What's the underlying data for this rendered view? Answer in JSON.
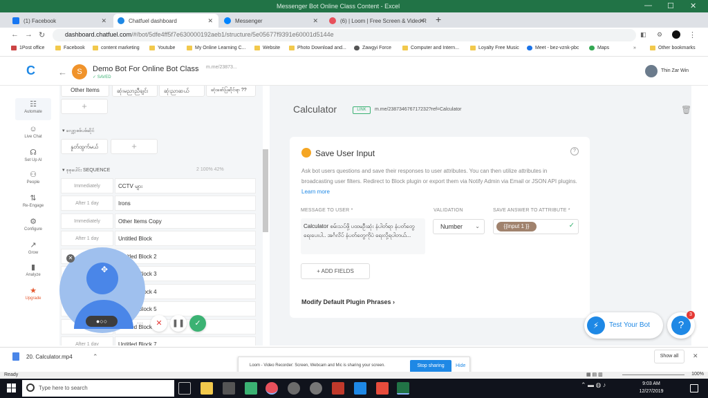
{
  "excel": {
    "title": "Messenger Bot Online Class Content - Excel",
    "min": "—",
    "max": "☐",
    "close": "✕"
  },
  "tabs": [
    {
      "title": "(1) Facebook",
      "color": "#1877f2"
    },
    {
      "title": "Chatfuel dashboard",
      "color": "#1e88e5"
    },
    {
      "title": "Messenger",
      "color": "#0084ff"
    },
    {
      "title": "(6) | Loom | Free Screen & Video R",
      "color": "#e8505b"
    }
  ],
  "address": {
    "domain": "dashboard.chatfuel.com",
    "path": "/#/bot/5dfe4ff5f7e630000192aeb1/structure/5e05677f9391e60001d5144e"
  },
  "bookmarks": [
    "1Post office",
    "Facebook",
    "content marketing",
    "Youtube",
    "My Online Learning C...",
    "Website",
    "Photo Download and...",
    "Zawgyi Force",
    "Computer and Intern...",
    "Loyalty Free Music",
    "Meet - bez-vznk-pbc",
    "Maps",
    "Other bookmarks"
  ],
  "header": {
    "logo": "C",
    "avatar_letter": "S",
    "bot_name": "Demo Bot For Online Bot Class",
    "saved": "SAVED",
    "bot_link": "m.me/23873...",
    "user_name": "Thin Zar Win"
  },
  "nav": [
    {
      "label": "Automate",
      "icon": "☷"
    },
    {
      "label": "Live Chat",
      "icon": "☺"
    },
    {
      "label": "Set Up AI",
      "icon": "☊"
    },
    {
      "label": "People",
      "icon": "⚇"
    },
    {
      "label": "Re-Engage",
      "icon": "⇅"
    },
    {
      "label": "Configure",
      "icon": "⚙"
    },
    {
      "label": "Grow",
      "icon": "↗"
    },
    {
      "label": "Analyze",
      "icon": "▮"
    },
    {
      "label": "Upgrade",
      "icon": "★"
    }
  ],
  "blocks": {
    "top_row": [
      "Other Items",
      "ဆုံးမညာညီချင်း",
      "ဆုံးညာဆယ်",
      "ဆုံးဖော်ပြဆိုင်ရာ ??"
    ],
    "group2_title": "လျှော့စစ်ပစ်ဆိုင်",
    "group2_blocks": [
      "နှုတ်ထွက်မယ်"
    ],
    "seq_title": "စုစုပေါင်း SEQUENCE",
    "seq_stats": "2   100%   42%",
    "sequence": [
      {
        "when": "Immediately",
        "name": "CCTV များ"
      },
      {
        "when": "After 1 day",
        "name": "Irons"
      },
      {
        "when": "Immediately",
        "name": "Other Items Copy"
      },
      {
        "when": "After 1 day",
        "name": "Untitled Block"
      },
      {
        "when": "",
        "name": "Untitled Block 2"
      },
      {
        "when": "",
        "name": "Untitled Block 3"
      },
      {
        "when": "",
        "name": "Untitled Block 4"
      },
      {
        "when": "",
        "name": "Untitled Block 5"
      },
      {
        "when": "After",
        "name": "Untitled Block 6"
      },
      {
        "when": "After 1 day",
        "name": "Untitled Block 7"
      }
    ]
  },
  "editor": {
    "block_title": "Calculator",
    "link_badge": "LINK",
    "link_url": "m.me/238734676717232?ref=Calculator",
    "plugin_title": "Save User Input",
    "help": "?",
    "desc": "Ask bot users questions and save their responses to user attributes. You can then utilize attributes in broadcasting user filters. Redirect to Block plugin or export them via Notify Admin via Email or JSON API plugins.",
    "learn_more": "Learn more",
    "label_message": "MESSAGE TO USER *",
    "label_validation": "VALIDATION",
    "label_attribute": "SAVE ANSWER TO ATTRIBUTE *",
    "message": "Calculator စမ်းသပ်ဖို့ ပထမဦးဆုံး နံပါတ်ရာ နံပတ်တွေ ရေးပေးပါ.. အင်္ဂလိပ် နံပတ်တွေကိုပဲ ရေးလို့ရပါတယ်...",
    "validation": "Number",
    "attribute": "{{input 1 }}",
    "add_fields": "ADD FIELDS",
    "modify": "Modify Default Plugin Phrases"
  },
  "fabs": {
    "test_bot": "Test Your Bot",
    "help_badge": "3"
  },
  "downloads": {
    "file": "20. Calculator.mp4",
    "show_all": "Show all"
  },
  "loom": {
    "share_text": "Loom - Video Recorder: Screen, Webcam and Mic is sharing your screen.",
    "stop": "Stop sharing",
    "hide": "Hide"
  },
  "status": {
    "ready": "Ready",
    "zoom": "100%"
  },
  "taskbar": {
    "search": "Type here to search",
    "time": "9:03 AM",
    "date": "12/27/2019"
  }
}
